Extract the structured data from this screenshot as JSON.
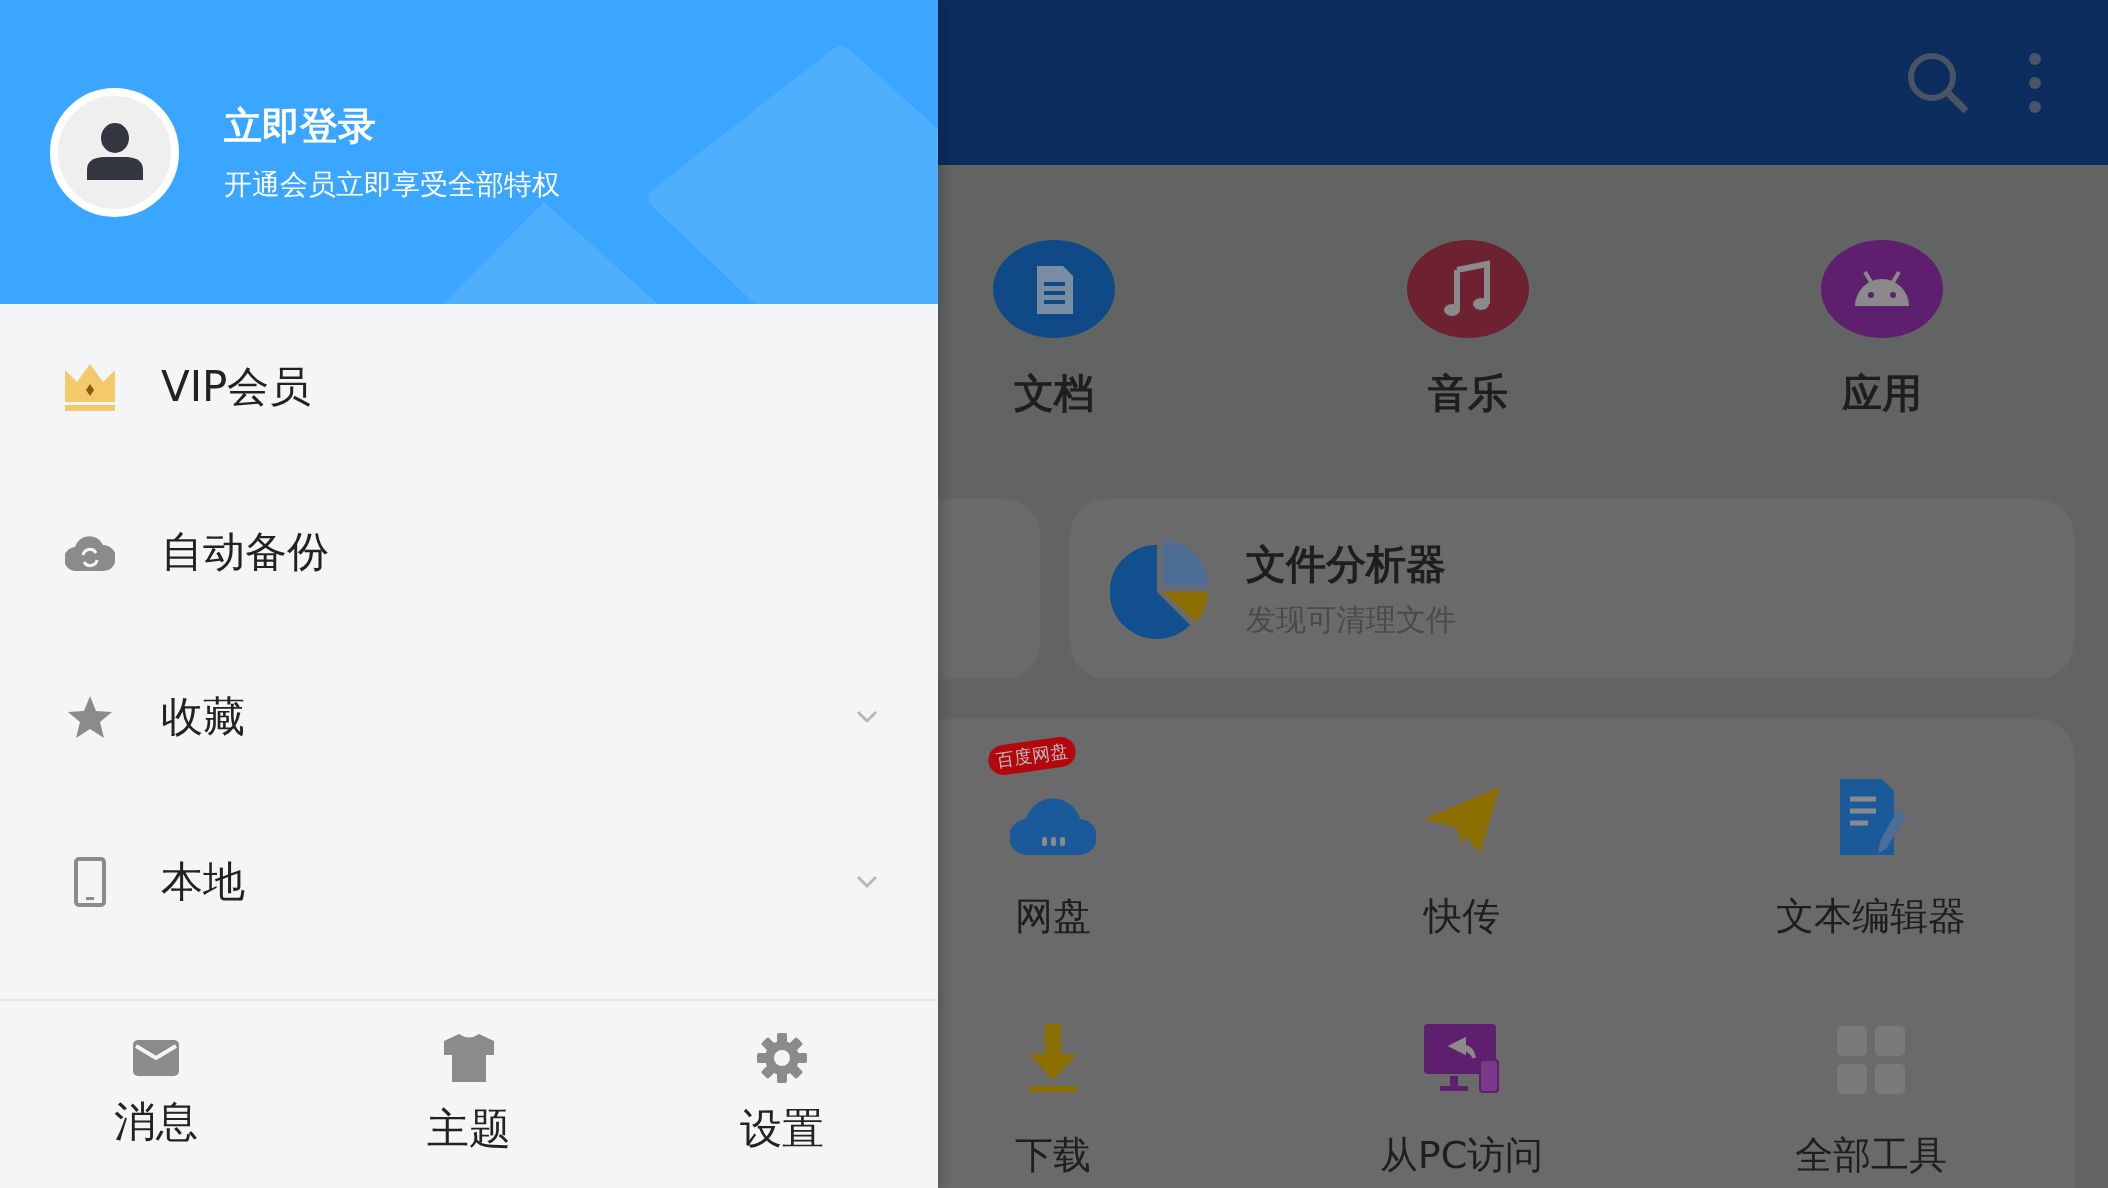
{
  "drawer": {
    "header": {
      "title": "立即登录",
      "subtitle": "开通会员立即享受全部特权"
    },
    "menu": [
      {
        "kind": "crown",
        "label": "VIP会员",
        "expandable": false
      },
      {
        "kind": "cloud-sync",
        "label": "自动备份",
        "expandable": false
      },
      {
        "kind": "star",
        "label": "收藏",
        "expandable": true
      },
      {
        "kind": "phone",
        "label": "本地",
        "expandable": true
      }
    ],
    "footer": [
      {
        "kind": "envelope",
        "label": "消息"
      },
      {
        "kind": "shirt",
        "label": "主题"
      },
      {
        "kind": "gear",
        "label": "设置"
      }
    ]
  },
  "main": {
    "categories": [
      {
        "kind": "document",
        "label": "文档"
      },
      {
        "kind": "music",
        "label": "音乐"
      },
      {
        "kind": "android",
        "label": "应用"
      }
    ],
    "analyzer_card": {
      "title": "文件分析器",
      "subtitle": "发现可清理文件"
    },
    "tools": [
      {
        "kind": "cloud",
        "label": "网盘",
        "badge": "百度网盘"
      },
      {
        "kind": "plane",
        "label": "快传"
      },
      {
        "kind": "text-editor",
        "label": "文本编辑器"
      },
      {
        "kind": "download",
        "label": "下载"
      },
      {
        "kind": "pc",
        "label": "从PC访问"
      },
      {
        "kind": "grid",
        "label": "全部工具"
      }
    ]
  }
}
